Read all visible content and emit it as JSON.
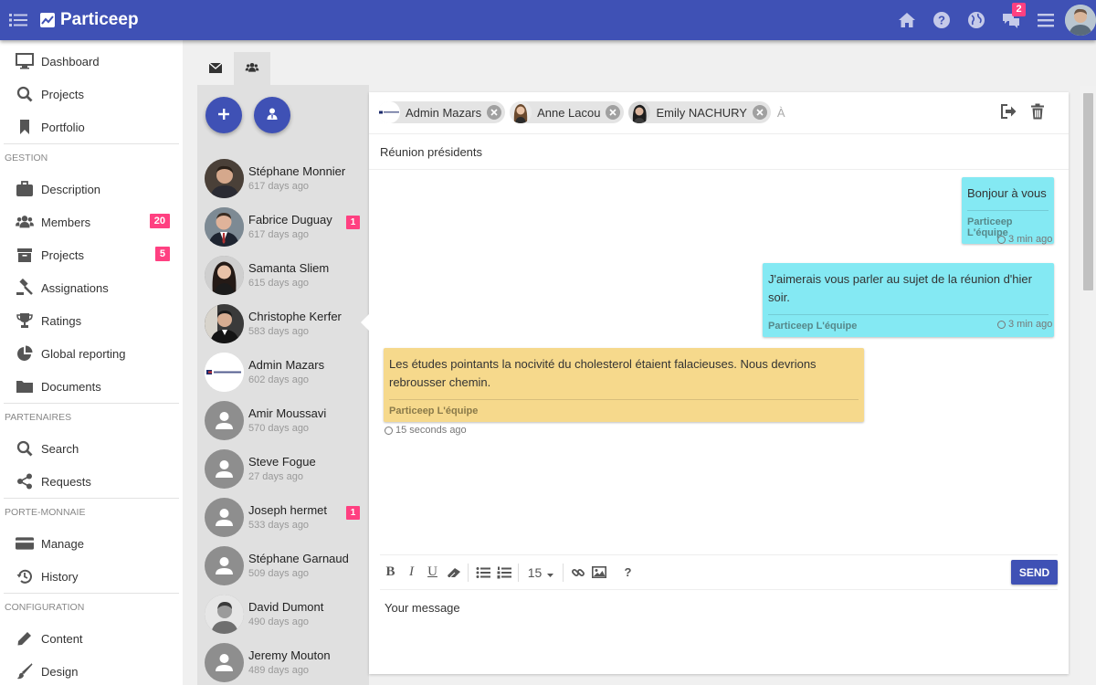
{
  "app": {
    "brand": "Particeep",
    "notification_count": "2"
  },
  "topbar": {
    "icons": [
      "home-icon",
      "help-icon",
      "globe-icon",
      "chat-icon",
      "menu-icon"
    ]
  },
  "nav": {
    "main": [
      {
        "label": "Dashboard",
        "icon": "monitor-icon"
      },
      {
        "label": "Projects",
        "icon": "search-icon"
      },
      {
        "label": "Portfolio",
        "icon": "bookmark-icon"
      }
    ],
    "sections": [
      {
        "title": "GESTION",
        "items": [
          {
            "label": "Description",
            "icon": "briefcase-icon",
            "badge": ""
          },
          {
            "label": "Members",
            "icon": "users-icon",
            "badge": "20"
          },
          {
            "label": "Projects",
            "icon": "archive-icon",
            "badge": "5"
          },
          {
            "label": "Assignations",
            "icon": "gavel-icon",
            "badge": ""
          },
          {
            "label": "Ratings",
            "icon": "trophy-icon",
            "badge": ""
          },
          {
            "label": "Global reporting",
            "icon": "pie-chart-icon",
            "badge": ""
          },
          {
            "label": "Documents",
            "icon": "folder-icon",
            "badge": ""
          }
        ]
      },
      {
        "title": "PARTENAIRES",
        "items": [
          {
            "label": "Search",
            "icon": "search-icon",
            "badge": ""
          },
          {
            "label": "Requests",
            "icon": "share-icon",
            "badge": ""
          }
        ]
      },
      {
        "title": "PORTE-MONNAIE",
        "items": [
          {
            "label": "Manage",
            "icon": "credit-card-icon",
            "badge": ""
          },
          {
            "label": "History",
            "icon": "history-icon",
            "badge": ""
          }
        ]
      },
      {
        "title": "CONFIGURATION",
        "items": [
          {
            "label": "Content",
            "icon": "pencil-icon",
            "badge": ""
          },
          {
            "label": "Design",
            "icon": "brush-icon",
            "badge": ""
          }
        ]
      }
    ]
  },
  "tabs": [
    {
      "icon": "envelope-icon",
      "active": false
    },
    {
      "icon": "users-icon",
      "active": true
    }
  ],
  "contacts": [
    {
      "name": "Stéphane Monnier",
      "time": "617 days ago",
      "unread": ""
    },
    {
      "name": "Fabrice Duguay",
      "time": "617 days ago",
      "unread": "1"
    },
    {
      "name": "Samanta Sliem",
      "time": "615 days ago",
      "unread": ""
    },
    {
      "name": "Christophe Kerfer",
      "time": "583 days ago",
      "unread": ""
    },
    {
      "name": "Admin Mazars",
      "time": "602 days ago",
      "unread": ""
    },
    {
      "name": "Amir Moussavi",
      "time": "570 days ago",
      "unread": ""
    },
    {
      "name": "Steve Fogue",
      "time": "27 days ago",
      "unread": ""
    },
    {
      "name": "Joseph hermet",
      "time": "533 days ago",
      "unread": "1"
    },
    {
      "name": "Stéphane Garnaud",
      "time": "509 days ago",
      "unread": ""
    },
    {
      "name": "David Dumont",
      "time": "490 days ago",
      "unread": ""
    },
    {
      "name": "Jeremy Mouton",
      "time": "489 days ago",
      "unread": ""
    }
  ],
  "conversation": {
    "recipients": [
      "Admin Mazars",
      "Anne Lacou",
      "Emily NACHURY"
    ],
    "to_label": "À",
    "subject": "Réunion présidents",
    "messages": [
      {
        "text": "Bonjour à vous",
        "signature": "Particeep L'équipe",
        "time": "3 min ago"
      },
      {
        "text": "J'aimerais vous parler au sujet de la réunion d'hier soir.",
        "signature": "Particeep L'équipe",
        "time": "3 min ago"
      },
      {
        "text": "Les études pointants la nocivité du cholesterol étaient falacieuses. Nous devrions rebrousser chemin.",
        "signature": "Particeep L'équipe",
        "time": "15 seconds ago"
      }
    ]
  },
  "editor": {
    "font_size": "15",
    "send_label": "SEND",
    "placeholder": "Your message"
  },
  "colors": {
    "primary": "#3f51b5",
    "badge": "#ff4081",
    "bubble_out": "#84e9f3",
    "bubble_in": "#f6d98c"
  }
}
